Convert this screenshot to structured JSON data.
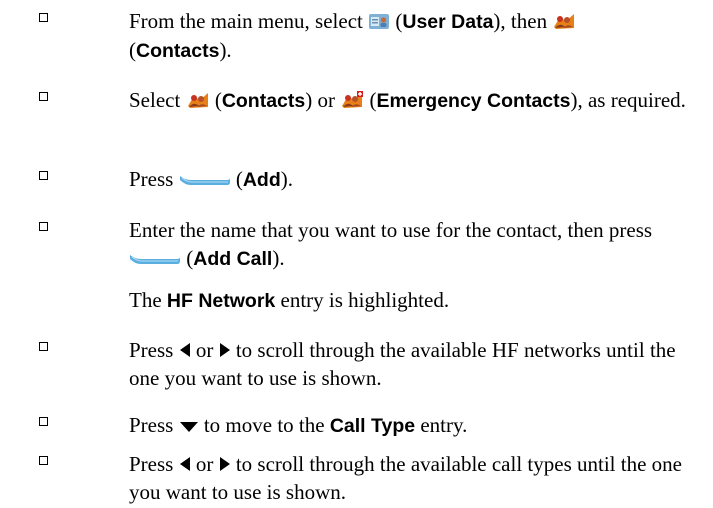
{
  "steps": [
    {
      "parts": {
        "a": "From the main menu, select ",
        "b1_open": " (",
        "b1": "User Data",
        "b1_close": "), then ",
        "b2_open": "(",
        "b2": "Contacts",
        "b2_close": ")."
      }
    },
    {
      "parts": {
        "a": "Select ",
        "b1_open": " (",
        "b1": "Contacts",
        "mid": ") or ",
        "b2_open": " (",
        "b2": "Emergency Contacts",
        "end": "), as required."
      }
    },
    {
      "parts": {
        "a": "Press ",
        "b1_open": " (",
        "b1": "Add",
        "end": ")."
      }
    },
    {
      "parts": {
        "a": "Enter the name that you want to use for the contact, then press ",
        "b1_open": " (",
        "b1": "Add Call",
        "end": ")."
      }
    },
    {
      "parts": {
        "a": "Press ",
        "or": " or ",
        "end": " to scroll through the available HF networks until the one you want to use is shown."
      }
    },
    {
      "parts": {
        "a": "Press ",
        "mid": " to move to the ",
        "b1": "Call Type",
        "end": " entry."
      }
    },
    {
      "parts": {
        "a": "Press ",
        "or": " or ",
        "end": " to scroll through the available call types until the one you want to use is shown."
      }
    }
  ],
  "note": {
    "a": "The ",
    "b": "HF Network",
    "c": " entry is highlighted."
  },
  "icons": {
    "user_data": "user-data-icon",
    "contacts": "contacts-icon",
    "emergency_contacts": "emergency-contacts-icon",
    "softkey": "softkey-icon",
    "left_arrow": "left-arrow-icon",
    "right_arrow": "right-arrow-icon",
    "down_arrow": "down-arrow-icon"
  },
  "colors": {
    "softkey": "#5aaee0",
    "contacts_orange": "#e8801a",
    "contacts_red": "#c8321e"
  }
}
